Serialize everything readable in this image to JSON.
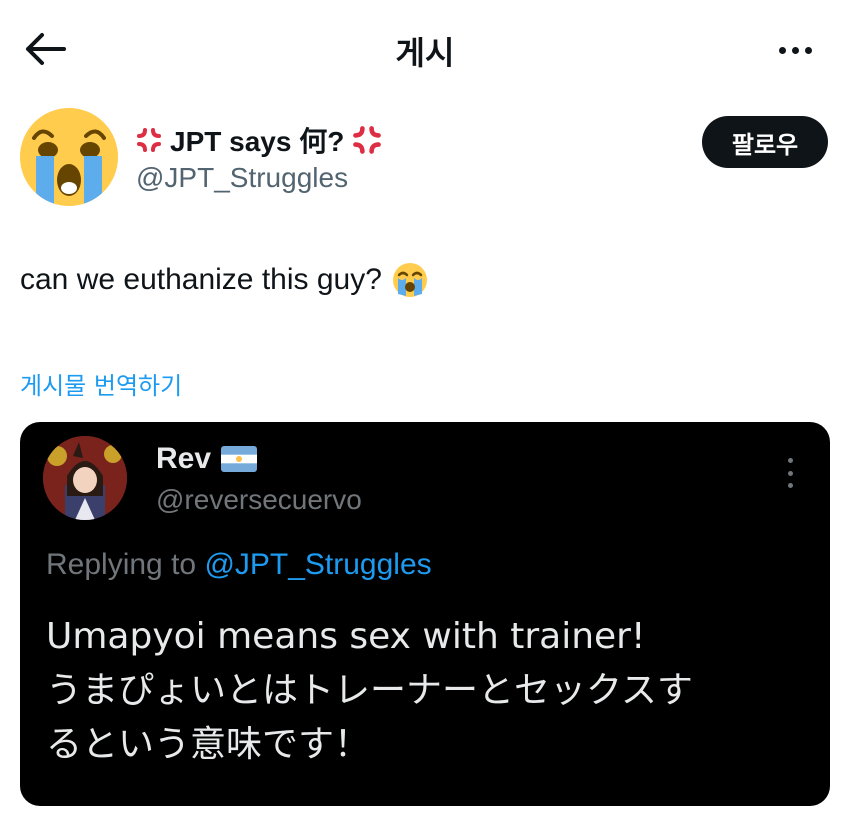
{
  "header": {
    "title": "게시",
    "back_icon": "arrow-left-icon",
    "more_icon": "more-horizontal-icon"
  },
  "author": {
    "display_name": "JPT says 何?",
    "handle": "@JPT_Struggles",
    "name_emoji": "anger-symbol-icon",
    "follow_label": "팔로우"
  },
  "tweet": {
    "text": "can we euthanize this guy?",
    "emoji": "loudly-crying-face-icon",
    "translate_label": "게시물 번역하기"
  },
  "quoted": {
    "display_name": "Rev",
    "flag": "argentina-flag-icon",
    "handle": "@reversecuervo",
    "replying_prefix": "Replying to",
    "replying_mention": "@JPT_Struggles",
    "body_line1": "Umapyoi means sex with trainer!",
    "body_line2": "うまぴょいとはトレーナーとセックスす",
    "body_line3": "るという意味です！"
  },
  "colors": {
    "accent": "#1d9bf0",
    "text": "#0f1419",
    "secondary": "#536471",
    "card_bg": "#000000"
  }
}
